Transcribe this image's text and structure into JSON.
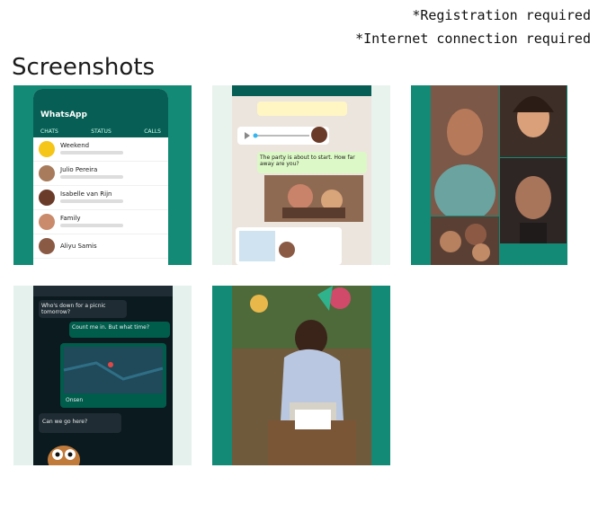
{
  "notes": {
    "registration": "*Registration required",
    "internet": "*Internet connection required"
  },
  "section": {
    "title": "Screenshots"
  },
  "screens": {
    "s1": {
      "app_title": "WhatsApp",
      "tabs": [
        "CHATS",
        "STATUS",
        "CALLS"
      ],
      "chats": [
        {
          "name": "Weekend"
        },
        {
          "name": "Julio Pereira"
        },
        {
          "name": "Isabelle van Rijn"
        },
        {
          "name": "Family"
        },
        {
          "name": "Aliyu Samis"
        }
      ]
    },
    "s2": {
      "message": "The party is about to start. How far away are you?"
    },
    "s4": {
      "prompt": "Who's down for a picnic tomorrow?",
      "reply": "Count me in. But what time?",
      "location_label": "Onsen",
      "question": "Can we go here?"
    }
  },
  "colors": {
    "brand": "#138a75",
    "header": "#075e54",
    "bubble": "#dcf8c6"
  }
}
